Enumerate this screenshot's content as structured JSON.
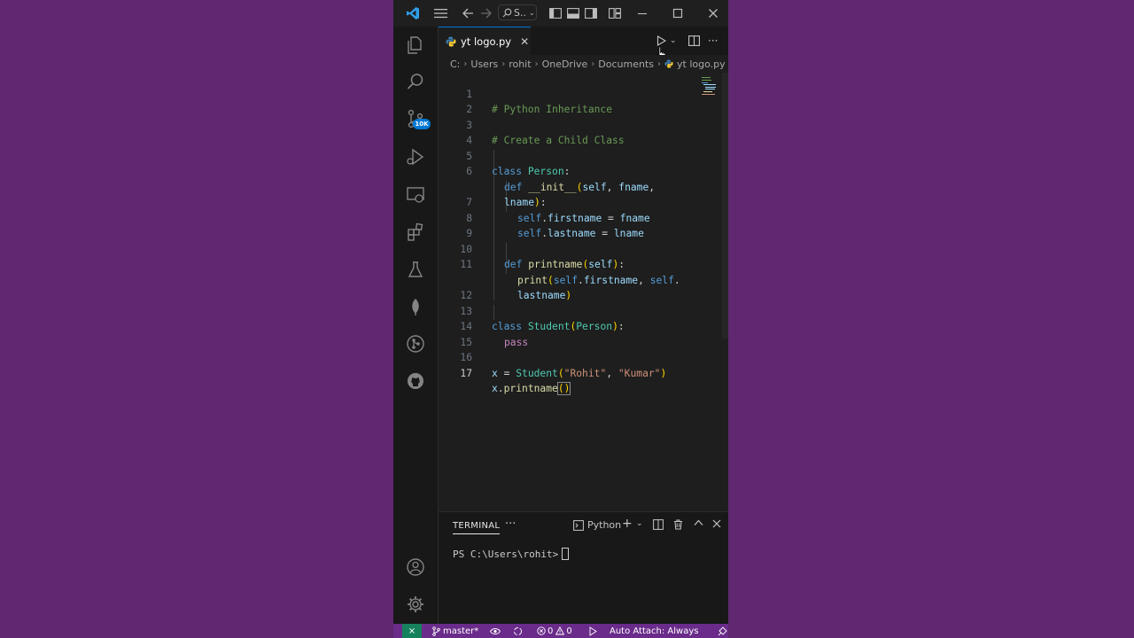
{
  "title_bar": {
    "search_label": "S..",
    "icons": [
      "vscode-logo",
      "menu",
      "back",
      "forward",
      "search",
      "toggle-sidebar",
      "toggle-panel",
      "toggle-secondary-sidebar",
      "customize-layout",
      "minimize",
      "maximize",
      "close"
    ]
  },
  "activity_bar": {
    "items": [
      "explorer",
      "search",
      "source-control",
      "run-debug",
      "remote-explorer",
      "extensions",
      "testing",
      "mongodb",
      "gitlens",
      "github"
    ],
    "source_control_badge": "10K",
    "bottom": [
      "accounts",
      "manage"
    ]
  },
  "tab": {
    "label": "yt logo.py",
    "close": "✕"
  },
  "breadcrumbs": [
    "C:",
    "Users",
    "rohit",
    "OneDrive",
    "Documents",
    "yt logo.py"
  ],
  "editor": {
    "active_line": 17,
    "lines": [
      {
        "n": "1",
        "text": "# Python Inheritance"
      },
      {
        "n": "2",
        "text": ""
      },
      {
        "n": "3",
        "text": "# Create a Child Class"
      },
      {
        "n": "4",
        "text": ""
      },
      {
        "n": "5",
        "text": "class Person:"
      },
      {
        "n": "6",
        "text": "def __init__(self, fname,"
      },
      {
        "n": "",
        "text": "lname):"
      },
      {
        "n": "7",
        "text": "self.firstname = fname"
      },
      {
        "n": "8",
        "text": "self.lastname = lname"
      },
      {
        "n": "9",
        "text": ""
      },
      {
        "n": "10",
        "text": "def printname(self):"
      },
      {
        "n": "11",
        "text": "print(self.firstname, self."
      },
      {
        "n": "",
        "text": "lastname)"
      },
      {
        "n": "12",
        "text": ""
      },
      {
        "n": "13",
        "text": "class Student(Person):"
      },
      {
        "n": "14",
        "text": "pass"
      },
      {
        "n": "15",
        "text": ""
      },
      {
        "n": "16",
        "text": "x = Student(\"Rohit\", \"Kumar\")"
      },
      {
        "n": "17",
        "text": "x.printname()"
      }
    ]
  },
  "terminal": {
    "tab_label": "TERMINAL",
    "more": "···",
    "shell_label": "Python",
    "prompt": "PS C:\\Users\\rohit>"
  },
  "status_bar": {
    "branch": "master*",
    "errors": "0",
    "warnings": "0",
    "auto_attach": "Auto Attach: Always"
  },
  "colors": {
    "background": "#5f2870",
    "editor_bg": "#1e1e1e",
    "status_bar": "#6a2b8a",
    "accent": "#0078d4"
  }
}
